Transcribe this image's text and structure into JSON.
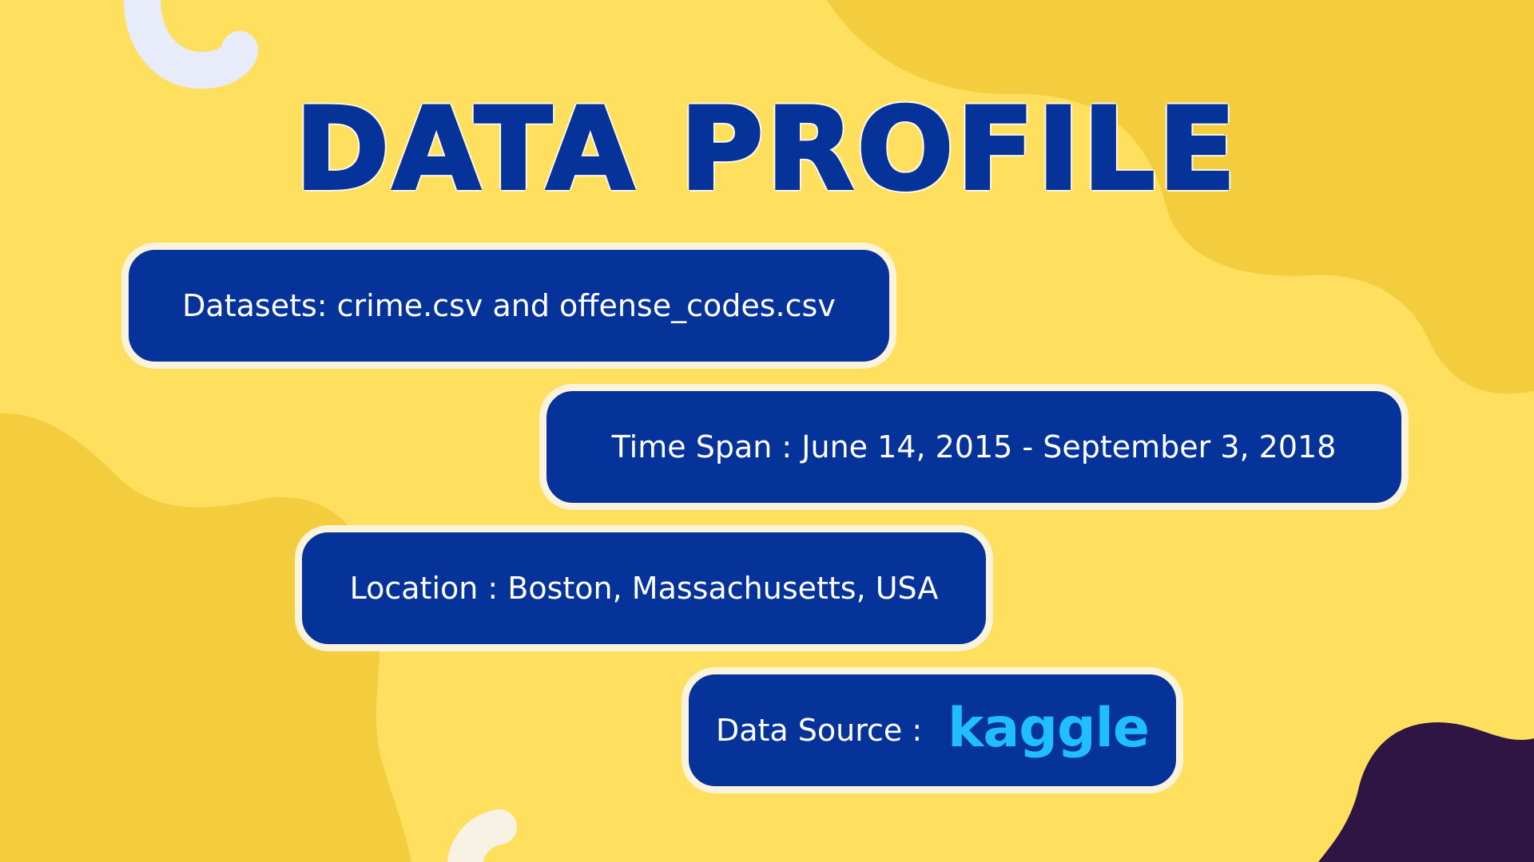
{
  "title": "DATA PROFILE",
  "items": {
    "datasets": "Datasets: crime.csv and offense_codes.csv",
    "time_span": "Time Span : June 14, 2015 - September 3, 2018",
    "location": "Location : Boston, Massachusetts, USA",
    "source_label": "Data Source :",
    "source_logo": "kaggle"
  },
  "colors": {
    "background": "#ffdf5e",
    "blob": "#f4cd3f",
    "pill": "#06339a",
    "pill_border": "#fbf3dc",
    "title": "#06339a",
    "kaggle": "#20beff",
    "corner_blob": "#2e1543"
  },
  "decorations": [
    "ring-arc-top-left",
    "ring-arc-bottom",
    "blob-top-right",
    "blob-left",
    "blob-bottom-right-dark"
  ]
}
